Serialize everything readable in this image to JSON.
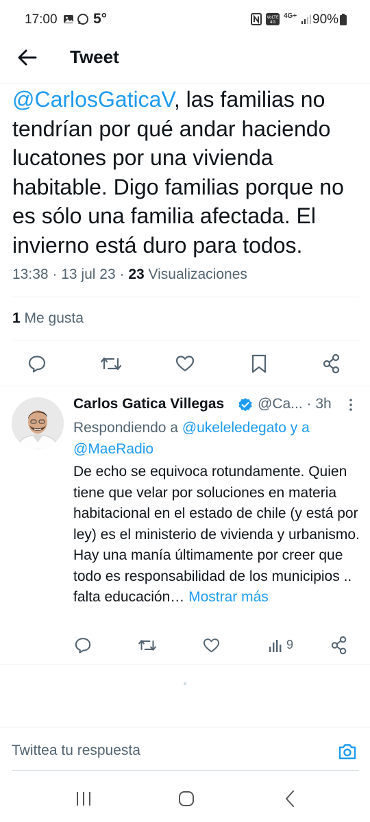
{
  "status_bar": {
    "time": "17:00",
    "temperature": "5°",
    "battery": "90%",
    "network": "4G+",
    "icons": [
      "gallery-icon",
      "whatsapp-icon",
      "nfc-icon",
      "volte-icon",
      "data-arrows-icon",
      "signal-icon",
      "battery-icon"
    ]
  },
  "header": {
    "title": "Tweet"
  },
  "tweet": {
    "mention": "@CarlosGaticaV",
    "text": ", las familias no tendrían por qué andar haciendo lucatones por una vivienda habitable. Digo familias porque no es sólo una familia afectada. El invierno está duro para todos.",
    "time": "13:38",
    "date": "13 jul 23",
    "views_count": "23",
    "views_label": "Visualizaciones",
    "likes_count": "1",
    "likes_label": "Me gusta"
  },
  "reply": {
    "name": "Carlos Gatica Villegas",
    "handle": "@Ca...",
    "time": "3h",
    "replying_prefix": "Respondiendo a",
    "replying_to": "@ukeleledegato y a @MaeRadio",
    "text": "De echo se equivoca rotundamente. Quien tiene que velar por soluciones en materia habitacional en el estado de chile (y está por ley) es el ministerio de vivienda y urbanismo. Hay una manía últimamente por creer que todo es responsabilidad de los municipios .. falta educación…",
    "show_more": "Mostrar más",
    "views": "9"
  },
  "compose": {
    "placeholder": "Twittea tu respuesta"
  },
  "colors": {
    "accent": "#1d9bf0",
    "text": "#0f1419",
    "secondary": "#536471"
  }
}
